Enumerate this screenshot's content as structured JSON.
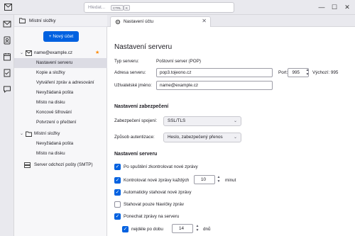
{
  "titlebar": {
    "search_placeholder": "Hledat...",
    "shortcut_ctrl": "CTRL",
    "shortcut_key": "K",
    "minimize": "—",
    "maximize": "☐",
    "close": "✕"
  },
  "folder_pane": {
    "header_label": "Místní složky",
    "new_message_label": "+ Nový účet",
    "account_label": "name@example.cz",
    "items": [
      "Nastavení serveru",
      "Kopie a složky",
      "Vytváření zpráv a adresování",
      "Nevyžádaná pošta",
      "Místo na disku",
      "Koncové šifrování",
      "Potvrzení o přečtení"
    ],
    "local_folders_label": "Místní složky",
    "local_items": [
      "Nevyžádaná pošta",
      "Místo na disku"
    ],
    "smtp_label": "Server odchozí pošty (SMTP)"
  },
  "tab": {
    "label": "Nastavení účtu",
    "close": "✕"
  },
  "main": {
    "title": "Nastavení serveru",
    "server_type_label": "Typ serveru:",
    "server_type_value": "Poštovní server (POP)",
    "server_address_label": "Adresa serveru:",
    "server_address_value": "pop3.tojeono.cz",
    "port_label": "Port:",
    "port_value": "995",
    "default_port_label": "Výchozí: 995",
    "username_label": "Uživatelské jméno:",
    "username_value": "name@example.cz",
    "security_heading": "Nastavení zabezpečení",
    "connection_security_label": "Zabezpečení spojení:",
    "connection_security_value": "SSL/TLS",
    "auth_method_label": "Způsob autentizace:",
    "auth_method_value": "Heslo, zabezpečený přenos",
    "server_settings_heading": "Nastavení serveru",
    "options": [
      {
        "label": "Po spuštění zkontrolovat nové zprávy",
        "checked": true
      },
      {
        "label": "Kontrolovat nové zprávy každých",
        "checked": true,
        "value": "10",
        "suffix": "minut"
      },
      {
        "label": "Automaticky stahovat nové zprávy",
        "checked": true
      },
      {
        "label": "Stahovat pouze hlavičky zpráv",
        "checked": false
      },
      {
        "label": "Ponechat zprávy na serveru",
        "checked": true
      },
      {
        "label": "nejdéle po dobu",
        "checked": true,
        "value": "14",
        "suffix": "dnů"
      }
    ],
    "check_mark": "✓"
  },
  "colors": {
    "accent": "#0061e0",
    "selected_row": "#dcdce4",
    "star": "#ff8a00"
  },
  "icons": {
    "app": "mail-icon",
    "spaces": [
      "mail-icon",
      "address-book-icon",
      "calendar-icon",
      "tasks-icon",
      "chat-icon"
    ]
  }
}
